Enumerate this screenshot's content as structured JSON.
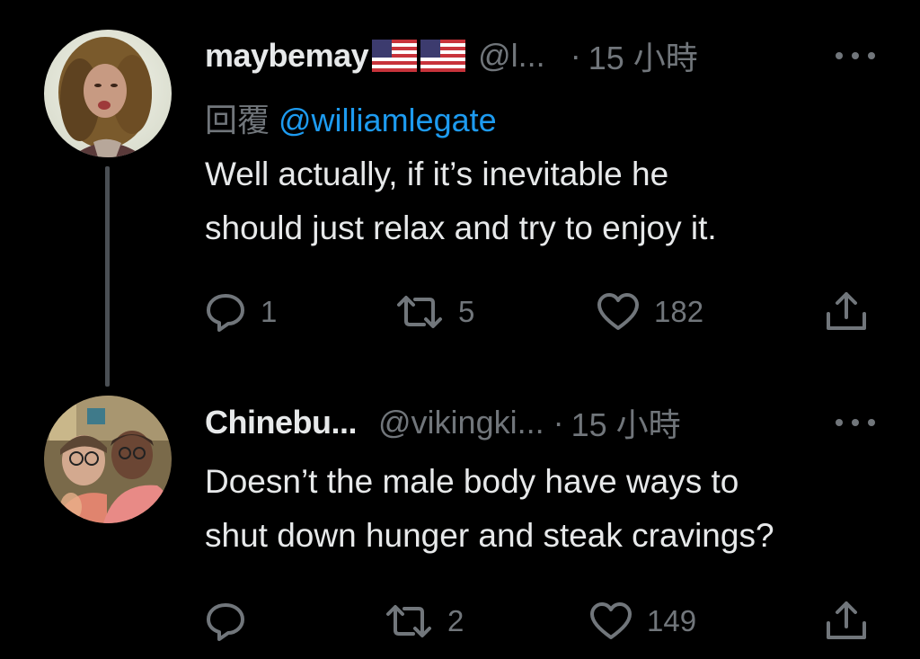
{
  "tweets": [
    {
      "display_name": "maybemay",
      "handle": "@l...",
      "dot": "·",
      "time": "15 小時",
      "reply_label": "回覆",
      "reply_mention": "@williamlegate",
      "lines": [
        "Well actually, if it’s inevitable he",
        "should just relax and try to enjoy it."
      ],
      "counts": {
        "reply": "1",
        "retweet": "5",
        "like": "182"
      }
    },
    {
      "display_name": "Chinebu...",
      "handle": "@vikingki...",
      "dot": "·",
      "time": "15 小時",
      "lines": [
        "Doesn’t the male body have ways to",
        "shut down hunger and steak cravings?"
      ],
      "counts": {
        "reply": "",
        "retweet": "2",
        "like": "149"
      }
    }
  ],
  "colors": {
    "background": "#000000",
    "text_primary": "#e7e9ea",
    "text_secondary": "#71767b",
    "link": "#1d9bf0",
    "thread_line": "#4a4f54"
  },
  "icons": [
    "reply-icon",
    "retweet-icon",
    "like-icon",
    "share-icon",
    "more-icon",
    "us-flag-icon"
  ]
}
